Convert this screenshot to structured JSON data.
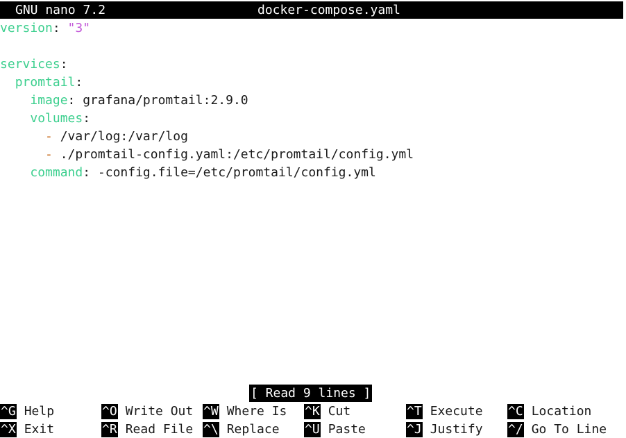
{
  "titlebar": {
    "app": "GNU nano 7.2",
    "filename": "docker-compose.yaml"
  },
  "file": {
    "lines": [
      [
        {
          "t": "version",
          "c": "k"
        },
        {
          "t": ": ",
          "c": "p"
        },
        {
          "t": "\"3\"",
          "c": "s"
        }
      ],
      [],
      [
        {
          "t": "services",
          "c": "k"
        },
        {
          "t": ":",
          "c": "p"
        }
      ],
      [
        {
          "t": "  ",
          "c": "p"
        },
        {
          "t": "promtail",
          "c": "k"
        },
        {
          "t": ":",
          "c": "p"
        }
      ],
      [
        {
          "t": "    ",
          "c": "p"
        },
        {
          "t": "image",
          "c": "k"
        },
        {
          "t": ": grafana/promtail:2.9.0",
          "c": "p"
        }
      ],
      [
        {
          "t": "    ",
          "c": "p"
        },
        {
          "t": "volumes",
          "c": "k"
        },
        {
          "t": ":",
          "c": "p"
        }
      ],
      [
        {
          "t": "      ",
          "c": "p"
        },
        {
          "t": "-",
          "c": "d"
        },
        {
          "t": " /var/log:/var/log",
          "c": "p"
        }
      ],
      [
        {
          "t": "      ",
          "c": "p"
        },
        {
          "t": "-",
          "c": "d"
        },
        {
          "t": " ./promtail-config.yaml:/etc/promtail/config.yml",
          "c": "p"
        }
      ],
      [
        {
          "t": "    ",
          "c": "p"
        },
        {
          "t": "command",
          "c": "k"
        },
        {
          "t": ": -config.file=/etc/promtail/config.yml",
          "c": "p"
        }
      ]
    ]
  },
  "status_message": "[ Read 9 lines ]",
  "shortcuts": [
    {
      "key": "^G",
      "label": "Help"
    },
    {
      "key": "^X",
      "label": "Exit"
    },
    {
      "key": "^O",
      "label": "Write Out"
    },
    {
      "key": "^R",
      "label": "Read File"
    },
    {
      "key": "^W",
      "label": "Where Is"
    },
    {
      "key": "^\\",
      "label": "Replace"
    },
    {
      "key": "^K",
      "label": "Cut"
    },
    {
      "key": "^U",
      "label": "Paste"
    },
    {
      "key": "^T",
      "label": "Execute"
    },
    {
      "key": "^J",
      "label": "Justify"
    },
    {
      "key": "^C",
      "label": "Location"
    },
    {
      "key": "^/",
      "label": "Go To Line"
    }
  ],
  "colors": {
    "key_yaml": "#3ccf8e",
    "string": "#c257d8",
    "dash": "#c4620e",
    "bar_bg": "#000000",
    "bar_fg": "#ffffff"
  }
}
